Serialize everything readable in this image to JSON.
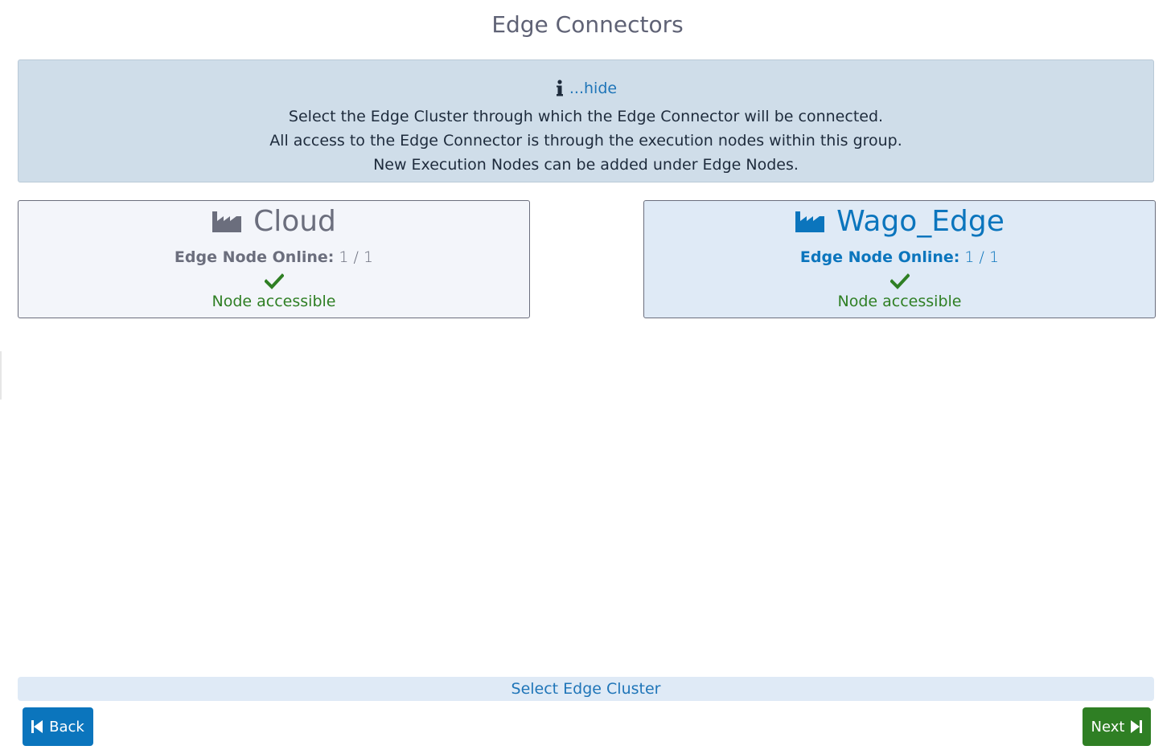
{
  "page": {
    "title": "Edge Connectors"
  },
  "info": {
    "toggle_label": "...hide",
    "icon": "info-icon",
    "lines": [
      "Select the Edge Cluster through which the Edge Connector will be connected.",
      "All access to the Edge Connector is through the execution nodes within this group.",
      "New Execution Nodes can be added under Edge Nodes."
    ]
  },
  "clusters": [
    {
      "name": "Cloud",
      "icon": "factory-icon",
      "online_label": "Edge Node Online:",
      "online_count": "1 / 1",
      "status_icon": "check-icon",
      "status": "Node accessible",
      "selected": false
    },
    {
      "name": "Wago_Edge",
      "icon": "factory-icon",
      "online_label": "Edge Node Online:",
      "online_count": "1 / 1",
      "status_icon": "check-icon",
      "status": "Node accessible",
      "selected": true
    }
  ],
  "footer": {
    "step_label": "Select Edge Cluster",
    "back_label": "Back",
    "next_label": "Next",
    "back_icon": "skip-back-icon",
    "next_icon": "skip-forward-icon"
  },
  "colors": {
    "primary": "#0b75bd",
    "success": "#2f7f24",
    "info_bg": "#cfdde9",
    "muted": "#6b6e7d"
  }
}
